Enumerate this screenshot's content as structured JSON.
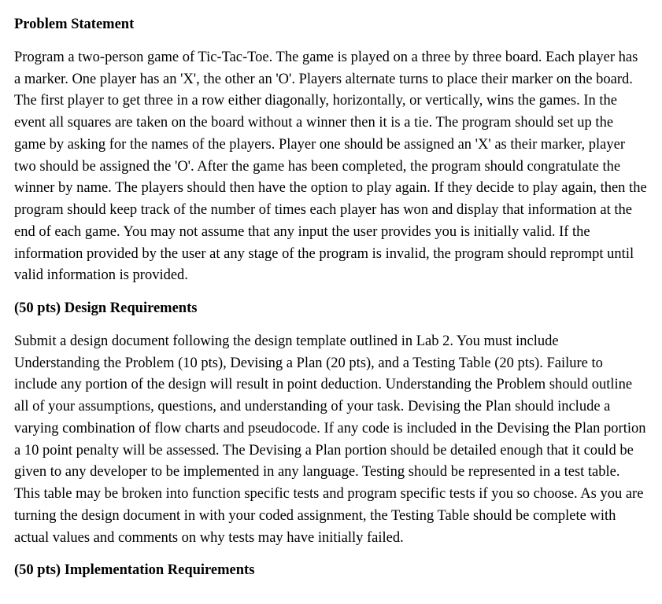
{
  "sections": [
    {
      "heading": "Problem Statement",
      "body": "Program a two-person game of Tic-Tac-Toe. The game is played on a three by three board. Each player has a marker. One player has an 'X', the other an 'O'. Players alternate turns to place their marker on the board. The first player to get three in a row either diagonally, horizontally, or vertically, wins the games. In the event all squares are taken on the board without a winner then it is a tie. The program should set up the game by asking for the names of the players. Player one should be assigned an 'X' as their marker, player two should be assigned the 'O'. After the game has been completed, the program should congratulate the winner by name. The players should then have the option to play again. If they decide to play again, then the program should keep track of the number of times each player has won and display that information at the end of each game. You may not assume that any input the user provides you is initially valid. If the information provided by the user at any stage of the program is invalid, the program should reprompt until valid information is provided."
    },
    {
      "heading": "(50 pts) Design Requirements",
      "body": "Submit a design document following the design template outlined in Lab 2. You must include Understanding the Problem (10 pts), Devising a Plan (20 pts), and a Testing Table (20 pts). Failure to include any portion of the design will result in point deduction. Understanding the Problem should outline all of your assumptions, questions, and understanding of your task. Devising the Plan should include a varying combination of flow charts and pseudocode. If any code is included in the Devising the Plan portion a 10 point penalty will be assessed. The Devising a Plan portion should be detailed enough that it could be given to any developer to be implemented in any language. Testing should be represented in a test table. This table may be broken into function specific tests and program specific tests if you so choose. As you are turning the design document in with your coded assignment, the Testing Table should be complete with actual values and comments on why tests may have initially failed."
    },
    {
      "heading": "(50 pts) Implementation Requirements",
      "body": ""
    }
  ]
}
